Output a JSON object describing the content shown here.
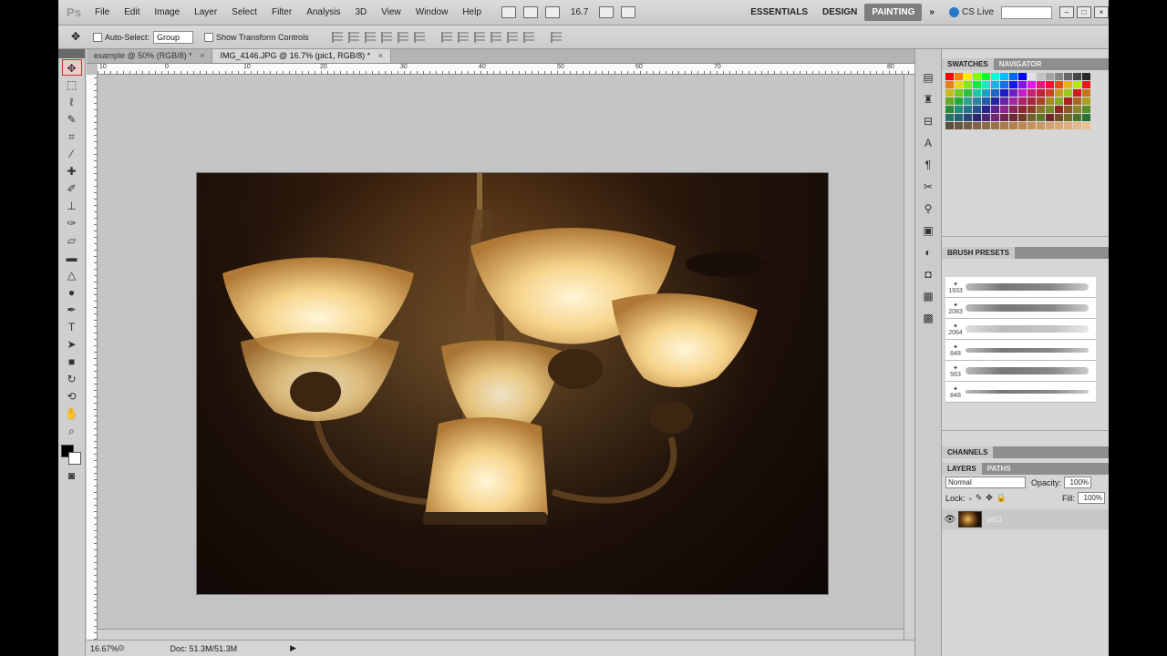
{
  "menubar": {
    "logo": "Ps",
    "items": [
      "File",
      "Edit",
      "Image",
      "Layer",
      "Select",
      "Filter",
      "Analysis",
      "3D",
      "View",
      "Window",
      "Help"
    ],
    "zoom": "16.7",
    "workspaces": [
      "ESSENTIALS",
      "DESIGN",
      "PAINTING"
    ],
    "active_workspace": "PAINTING",
    "cslive": "CS Live"
  },
  "options": {
    "auto_select": "Auto-Select:",
    "group": "Group",
    "transform": "Show Transform Controls"
  },
  "tabs": [
    {
      "label": "example @ 50% (RGB/8) *"
    },
    {
      "label": "IMG_4146.JPG @ 16.7% (pic1, RGB/8) *"
    }
  ],
  "status": {
    "zoom": "16.67%",
    "doc": "Doc: 51.3M/51.3M"
  },
  "panels": {
    "swatches_tab": "SWATCHES",
    "navigator_tab": "NAVIGATOR",
    "brush_presets": "BRUSH PRESETS",
    "channels": "CHANNELS",
    "layers_tab": "LAYERS",
    "paths_tab": "PATHS",
    "blend_mode": "Normal",
    "opacity_label": "Opacity:",
    "opacity": "100%",
    "lock_label": "Lock:",
    "fill_label": "Fill:",
    "fill": "100%",
    "layer_name": "pic1",
    "brush_sizes": [
      "1933",
      "2083",
      "2064",
      "848",
      "563",
      "848"
    ]
  },
  "rulers": {
    "top": [
      "10",
      "0",
      "10",
      "20",
      "30",
      "40",
      "50",
      "60",
      "70",
      "80"
    ]
  }
}
